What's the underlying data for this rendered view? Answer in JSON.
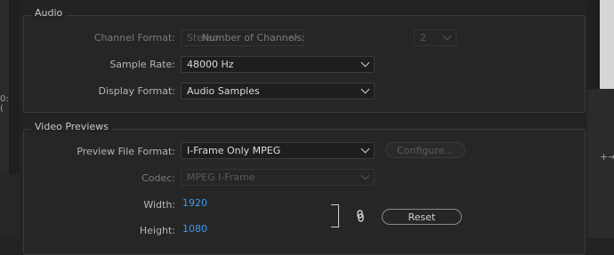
{
  "audio": {
    "title": "Audio",
    "channel_format": {
      "label": "Channel Format:",
      "value": "Stereo"
    },
    "num_channels": {
      "label": "Number of Channels:",
      "value": "2"
    },
    "sample_rate": {
      "label": "Sample Rate:",
      "value": "48000 Hz"
    },
    "display_format": {
      "label": "Display Format:",
      "value": "Audio Samples"
    }
  },
  "video_previews": {
    "title": "Video Previews",
    "preview_file_format": {
      "label": "Preview File Format:",
      "value": "I-Frame Only MPEG"
    },
    "configure_label": "Configure...",
    "codec": {
      "label": "Codec:",
      "value": "MPEG I-Frame"
    },
    "width": {
      "label": "Width:",
      "value": "1920"
    },
    "height": {
      "label": "Height:",
      "value": "1080"
    },
    "reset_label": "Reset"
  },
  "background": {
    "left_glyph": "0:(",
    "right_glyph": "+⇥"
  },
  "icons": {
    "chain": "chain-link-icon",
    "bracket": "constrain-bracket-icon",
    "dropdown": "chevron-down-icon"
  }
}
